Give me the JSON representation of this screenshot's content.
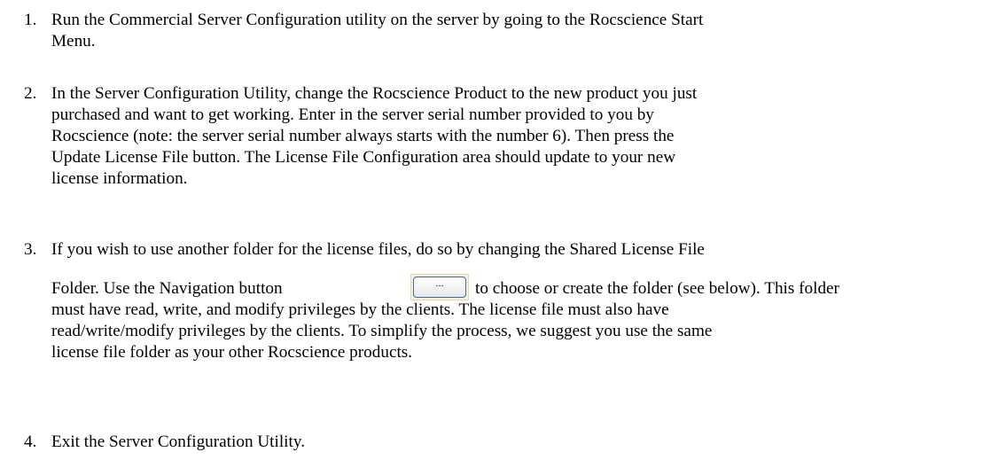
{
  "steps": [
    {
      "number": "1.",
      "lines": [
        "Run the Commercial Server Configuration utility on the server by going to the Rocscience Start",
        "Menu."
      ]
    },
    {
      "number": "2.",
      "lines": [
        "In the Server Configuration Utility, change the Rocscience Product to the new product you just",
        "purchased and want to get working.  Enter in the server serial number provided to you by",
        "Rocscience (note: the server serial number always starts with the number 6).  Then press the",
        "Update License File button. The License File Configuration area should update to your new",
        "license information."
      ]
    },
    {
      "number": "3.",
      "lines": [
        "If you wish to use another folder for the license files, do so by changing the Shared License File",
        "Folder.  Use the Navigation button",
        "to choose or create the folder (see below).  This folder",
        "must have read, write, and modify privileges by the clients.  The license file must also have",
        "read/write/modify privileges by the clients.  To simplify the process, we suggest you use the same",
        "license file folder as your other Rocscience products."
      ]
    },
    {
      "number": "4.",
      "lines": [
        "Exit the Server Configuration Utility."
      ]
    }
  ],
  "navigation_button": {
    "label": "..."
  }
}
